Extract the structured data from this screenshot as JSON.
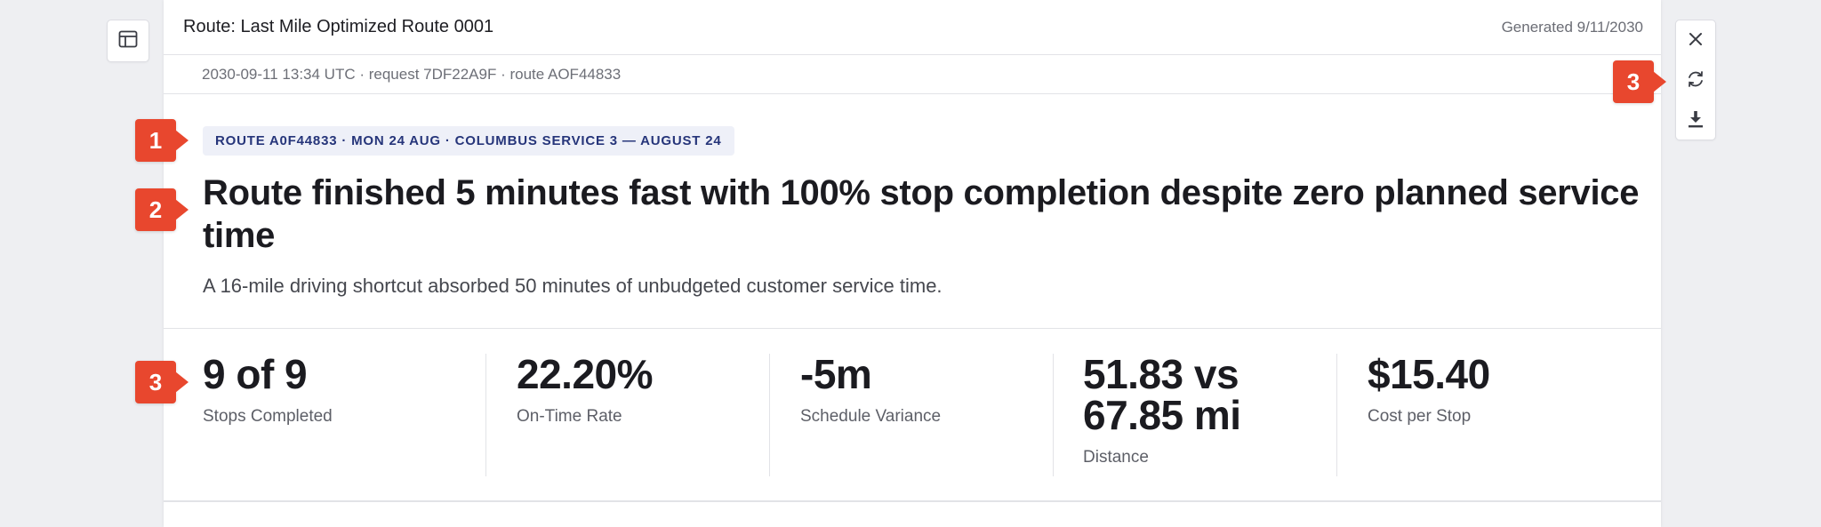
{
  "header": {
    "title": "Route: Last Mile Optimized Route 0001",
    "generated": "Generated 9/11/2030"
  },
  "meta": {
    "line": "2030-09-11 13:34 UTC · request 7DF22A9F · route AOF44833"
  },
  "report": {
    "tag": "ROUTE A0F44833 · MON 24 AUG · COLUMBUS SERVICE 3 — AUGUST 24",
    "headline": "Route finished 5 minutes fast with 100% stop completion despite zero planned service time",
    "subhead": "A 16-mile driving shortcut absorbed 50 minutes of unbudgeted customer service time."
  },
  "metrics": [
    {
      "value": "9 of 9",
      "label": "Stops Completed"
    },
    {
      "value": "22.20%",
      "label": "On-Time Rate"
    },
    {
      "value": "-5m",
      "label": "Schedule Variance"
    },
    {
      "value": "51.83 vs 67.85 mi",
      "label": "Distance"
    },
    {
      "value": "$15.40",
      "label": "Cost per Stop"
    }
  ],
  "toolbar": {
    "left_icon": "layout-icon",
    "right_icons": [
      "close-icon",
      "refresh-icon",
      "download-icon"
    ]
  },
  "annotations": [
    {
      "label": "1"
    },
    {
      "label": "2"
    },
    {
      "label": "3"
    },
    {
      "label": "3"
    }
  ],
  "colors": {
    "badge": "#e8472e",
    "tag_text": "#26357a",
    "tag_bg": "#eef0f8"
  }
}
